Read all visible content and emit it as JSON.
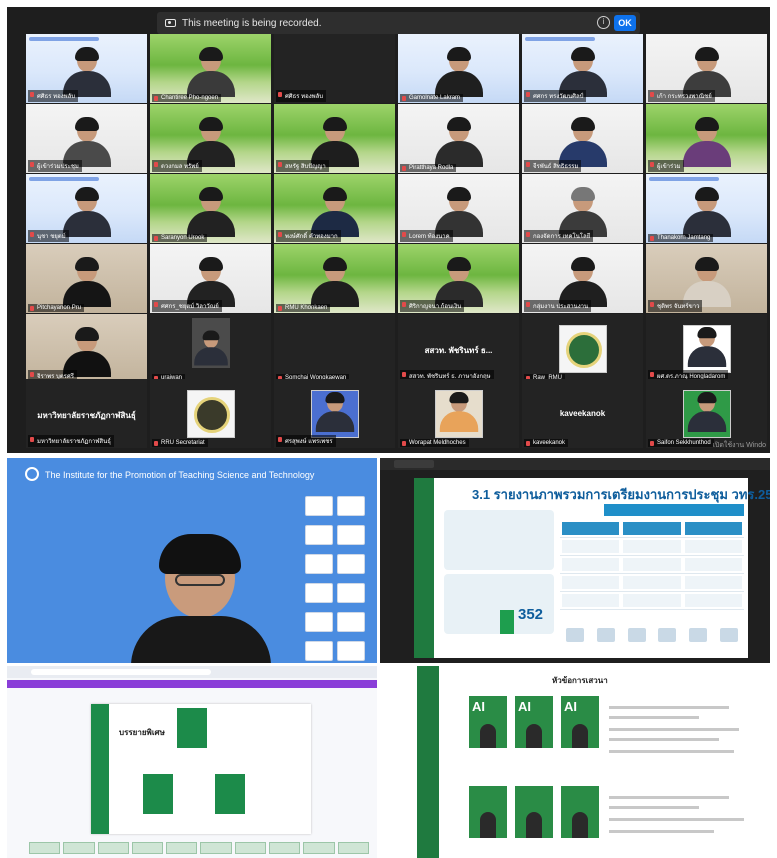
{
  "recording_banner": {
    "text": "This meeting is being recorded.",
    "ok_label": "OK"
  },
  "participants": [
    "ศศิธร ทองพลับ",
    "Chantiree Pho-ngoen",
    "ศศิธร ทองพลับ",
    "Gamolnate Lakram",
    "ศศกร ทรงวัฒนศิลป์",
    "เก้า กระทรวงพาณิชย์",
    "ผู้เข้าร่วมประชุม",
    "ดวงกมล ทรัพย์",
    "สหรัฐ สิบปัญญา",
    "Piratthaya Rodla",
    "จีรพันธ์ สิทธิธรรม",
    "ผู้เข้าร่วม",
    "นุชา ชยุตม์",
    "Saranyon Urook",
    "พงษ์ศักดิ์ คำทองมาก",
    "Lorem ท้องนาค",
    "กองจัดการ เทคโนโลยี",
    "Thanakorn Jamtang",
    "Pitchayanon Pru",
    "ศศกร_ชยุตม์ วิลาวัณย์",
    "RMU Khonkaen",
    "ศิริกาญจนา ก้อนเงิน",
    "กลุ่มงาน ประสานงาน",
    "ชุติพร จันทร์ขาว",
    "จิราพร บุตรศรี",
    "uraiwan",
    "Somchai Wongkaewan",
    "สสวท. พัชรินทร์ ธ. ภาษาอังกฤษ",
    "Raw_RMU",
    "ผศ.ดร.ภาณุ Hongladarom"
  ],
  "center_name_label": "สสวท. พัชรินทร์ ธ...",
  "bottom_row": {
    "left_label": "มหาวิทยาลัยราชภัฏกาฬสินธุ์",
    "left_name": "มหาวิทยาลัยราชภัฏกาฬสินธุ์",
    "tiles": [
      "RRU Secretariat",
      "ศรสุพงษ์ แพรเพชร",
      "Worapat Meldhoches",
      "kaveekanok",
      "Saifon Sekkhunthod"
    ],
    "kaveekanok_big": "kaveekanok"
  },
  "windows_watermark": "เปิดใช้งาน Windo",
  "ipst": {
    "title": "The Institute for the Promotion of Teaching Science and Technology"
  },
  "report_slide": {
    "headline": "3.1 รายงานภาพรวมการเตรียมงานการประชุม วทร.25",
    "big_number": "352"
  },
  "browser": {
    "page_title": "บรรยายพิเศษ"
  },
  "agenda": {
    "heading": "หัวข้อการเสวนา",
    "ai_label": "AI"
  }
}
